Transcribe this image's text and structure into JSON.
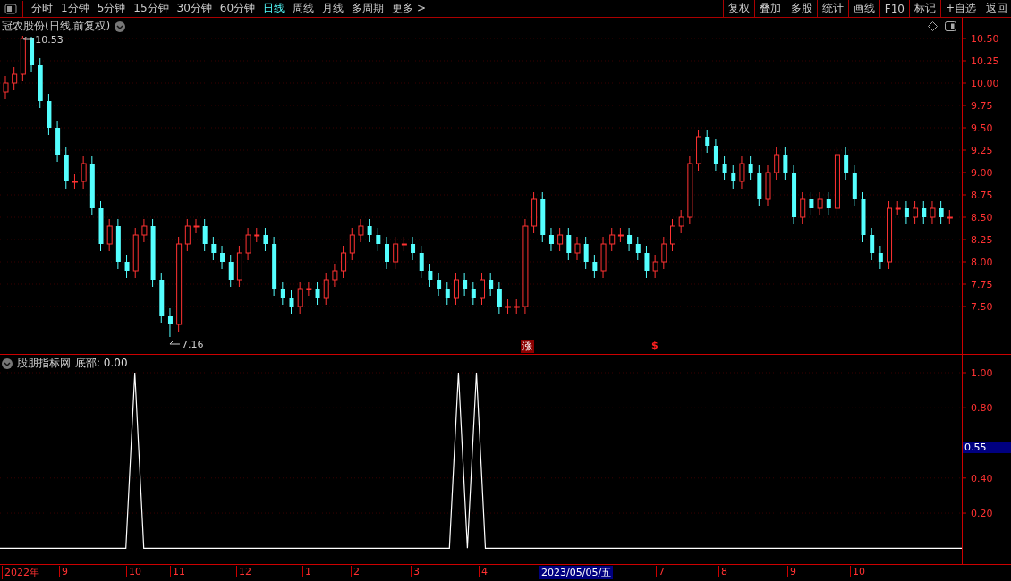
{
  "periods": [
    {
      "label": "分时",
      "selected": false
    },
    {
      "label": "1分钟",
      "selected": false
    },
    {
      "label": "5分钟",
      "selected": false
    },
    {
      "label": "15分钟",
      "selected": false
    },
    {
      "label": "30分钟",
      "selected": false
    },
    {
      "label": "60分钟",
      "selected": false
    },
    {
      "label": "日线",
      "selected": true
    },
    {
      "label": "周线",
      "selected": false
    },
    {
      "label": "月线",
      "selected": false
    },
    {
      "label": "多周期",
      "selected": false
    },
    {
      "label": "更多 >",
      "selected": false
    }
  ],
  "tools": [
    "复权",
    "叠加",
    "多股",
    "统计",
    "画线",
    "F10",
    "标记",
    "+自选",
    "返回"
  ],
  "main_chart": {
    "title": "冠农股份(日线,前复权)",
    "high_label": "10.53",
    "low_label": "7.16",
    "signal_badge": "涨",
    "signal_mark": "$",
    "chart_data": {
      "type": "candlestick",
      "grid": true,
      "ylim": [
        6.96,
        10.73
      ],
      "yticks": [
        {
          "value": 10.5,
          "label": "10.50"
        },
        {
          "value": 10.25,
          "label": "10.25"
        },
        {
          "value": 10,
          "label": "10.00"
        },
        {
          "value": 9.75,
          "label": "9.75"
        },
        {
          "value": 9.5,
          "label": "9.50"
        },
        {
          "value": 9.25,
          "label": "9.25"
        },
        {
          "value": 9,
          "label": "9.00"
        },
        {
          "value": 8.75,
          "label": "8.75"
        },
        {
          "value": 8.5,
          "label": "8.50"
        },
        {
          "value": 8.25,
          "label": "8.25"
        },
        {
          "value": 8,
          "label": "8.00"
        },
        {
          "value": 7.75,
          "label": "7.75"
        },
        {
          "value": 7.5,
          "label": "7.50"
        }
      ],
      "ohlc": [
        [
          9.9,
          10.08,
          9.82,
          10.0
        ],
        [
          10.0,
          10.18,
          9.92,
          10.1
        ],
        [
          10.1,
          10.53,
          10.02,
          10.5
        ],
        [
          10.5,
          10.52,
          10.12,
          10.2
        ],
        [
          10.2,
          10.28,
          9.72,
          9.8
        ],
        [
          9.8,
          9.88,
          9.42,
          9.5
        ],
        [
          9.5,
          9.58,
          9.12,
          9.2
        ],
        [
          9.2,
          9.28,
          8.82,
          8.9
        ],
        [
          8.9,
          8.98,
          8.82,
          8.9
        ],
        [
          8.9,
          9.18,
          8.82,
          9.1
        ],
        [
          9.1,
          9.18,
          8.52,
          8.6
        ],
        [
          8.6,
          8.68,
          8.12,
          8.2
        ],
        [
          8.2,
          8.48,
          8.12,
          8.4
        ],
        [
          8.4,
          8.48,
          7.92,
          8.0
        ],
        [
          8.0,
          8.08,
          7.82,
          7.9
        ],
        [
          7.9,
          8.38,
          7.82,
          8.3
        ],
        [
          8.3,
          8.48,
          8.22,
          8.4
        ],
        [
          8.4,
          8.48,
          7.72,
          7.8
        ],
        [
          7.8,
          7.88,
          7.32,
          7.4
        ],
        [
          7.4,
          7.48,
          7.16,
          7.3
        ],
        [
          7.3,
          8.28,
          7.22,
          8.2
        ],
        [
          8.2,
          8.48,
          8.12,
          8.4
        ],
        [
          8.4,
          8.48,
          8.32,
          8.4
        ],
        [
          8.4,
          8.48,
          8.12,
          8.2
        ],
        [
          8.2,
          8.28,
          8.02,
          8.1
        ],
        [
          8.1,
          8.18,
          7.92,
          8.0
        ],
        [
          8.0,
          8.08,
          7.72,
          7.8
        ],
        [
          7.8,
          8.18,
          7.72,
          8.1
        ],
        [
          8.1,
          8.38,
          8.02,
          8.3
        ],
        [
          8.3,
          8.38,
          8.22,
          8.3
        ],
        [
          8.3,
          8.38,
          8.12,
          8.2
        ],
        [
          8.2,
          8.28,
          7.62,
          7.7
        ],
        [
          7.7,
          7.78,
          7.52,
          7.6
        ],
        [
          7.6,
          7.68,
          7.42,
          7.5
        ],
        [
          7.5,
          7.78,
          7.42,
          7.7
        ],
        [
          7.7,
          7.78,
          7.62,
          7.7
        ],
        [
          7.7,
          7.78,
          7.52,
          7.6
        ],
        [
          7.6,
          7.88,
          7.52,
          7.8
        ],
        [
          7.8,
          7.98,
          7.72,
          7.9
        ],
        [
          7.9,
          8.18,
          7.82,
          8.1
        ],
        [
          8.1,
          8.38,
          8.02,
          8.3
        ],
        [
          8.3,
          8.48,
          8.22,
          8.4
        ],
        [
          8.4,
          8.48,
          8.22,
          8.3
        ],
        [
          8.3,
          8.38,
          8.12,
          8.2
        ],
        [
          8.2,
          8.28,
          7.92,
          8.0
        ],
        [
          8.0,
          8.28,
          7.92,
          8.2
        ],
        [
          8.2,
          8.28,
          8.12,
          8.2
        ],
        [
          8.2,
          8.28,
          8.02,
          8.1
        ],
        [
          8.1,
          8.18,
          7.82,
          7.9
        ],
        [
          7.9,
          7.98,
          7.72,
          7.8
        ],
        [
          7.8,
          7.88,
          7.62,
          7.7
        ],
        [
          7.7,
          7.78,
          7.52,
          7.6
        ],
        [
          7.6,
          7.88,
          7.52,
          7.8
        ],
        [
          7.8,
          7.88,
          7.62,
          7.7
        ],
        [
          7.7,
          7.78,
          7.52,
          7.6
        ],
        [
          7.6,
          7.88,
          7.52,
          7.8
        ],
        [
          7.8,
          7.88,
          7.62,
          7.7
        ],
        [
          7.7,
          7.78,
          7.42,
          7.5
        ],
        [
          7.5,
          7.58,
          7.42,
          7.5
        ],
        [
          7.5,
          7.58,
          7.42,
          7.5
        ],
        [
          7.5,
          8.48,
          7.42,
          8.4
        ],
        [
          8.4,
          8.78,
          8.32,
          8.7
        ],
        [
          8.7,
          8.78,
          8.22,
          8.3
        ],
        [
          8.3,
          8.38,
          8.12,
          8.2
        ],
        [
          8.2,
          8.38,
          8.12,
          8.3
        ],
        [
          8.3,
          8.38,
          8.02,
          8.1
        ],
        [
          8.1,
          8.28,
          8.02,
          8.2
        ],
        [
          8.2,
          8.28,
          7.92,
          8.0
        ],
        [
          8.0,
          8.08,
          7.82,
          7.9
        ],
        [
          7.9,
          8.28,
          7.82,
          8.2
        ],
        [
          8.2,
          8.38,
          8.12,
          8.3
        ],
        [
          8.3,
          8.38,
          8.22,
          8.3
        ],
        [
          8.3,
          8.38,
          8.12,
          8.2
        ],
        [
          8.2,
          8.28,
          8.02,
          8.1
        ],
        [
          8.1,
          8.18,
          7.82,
          7.9
        ],
        [
          7.9,
          8.08,
          7.82,
          8.0
        ],
        [
          8.0,
          8.28,
          7.92,
          8.2
        ],
        [
          8.2,
          8.48,
          8.12,
          8.4
        ],
        [
          8.4,
          8.58,
          8.32,
          8.5
        ],
        [
          8.5,
          9.18,
          8.42,
          9.1
        ],
        [
          9.1,
          9.48,
          9.02,
          9.4
        ],
        [
          9.4,
          9.48,
          9.22,
          9.3
        ],
        [
          9.3,
          9.38,
          9.02,
          9.1
        ],
        [
          9.1,
          9.18,
          8.92,
          9.0
        ],
        [
          9.0,
          9.08,
          8.82,
          8.9
        ],
        [
          8.9,
          9.18,
          8.82,
          9.1
        ],
        [
          9.1,
          9.18,
          8.92,
          9.0
        ],
        [
          9.0,
          9.08,
          8.62,
          8.7
        ],
        [
          8.7,
          9.08,
          8.62,
          9.0
        ],
        [
          9.0,
          9.28,
          8.92,
          9.2
        ],
        [
          9.2,
          9.28,
          8.92,
          9.0
        ],
        [
          9.0,
          9.08,
          8.42,
          8.5
        ],
        [
          8.5,
          8.78,
          8.42,
          8.7
        ],
        [
          8.7,
          8.78,
          8.52,
          8.6
        ],
        [
          8.6,
          8.78,
          8.52,
          8.7
        ],
        [
          8.7,
          8.78,
          8.52,
          8.6
        ],
        [
          8.6,
          9.28,
          8.52,
          9.2
        ],
        [
          9.2,
          9.28,
          8.92,
          9.0
        ],
        [
          9.0,
          9.08,
          8.62,
          8.7
        ],
        [
          8.7,
          8.78,
          8.22,
          8.3
        ],
        [
          8.3,
          8.38,
          8.02,
          8.1
        ],
        [
          8.1,
          8.18,
          7.92,
          8.0
        ],
        [
          8.0,
          8.68,
          7.92,
          8.6
        ],
        [
          8.6,
          8.68,
          8.52,
          8.6
        ],
        [
          8.6,
          8.68,
          8.42,
          8.5
        ],
        [
          8.5,
          8.68,
          8.42,
          8.6
        ],
        [
          8.6,
          8.68,
          8.42,
          8.5
        ],
        [
          8.5,
          8.68,
          8.42,
          8.6
        ],
        [
          8.6,
          8.68,
          8.42,
          8.5
        ],
        [
          8.5,
          8.58,
          8.42,
          8.5
        ]
      ]
    }
  },
  "indicator": {
    "name": "股朋指标网",
    "reading": ": 0.00",
    "cursor_value": "0.55",
    "chart_data": {
      "type": "line",
      "grid": true,
      "ylim": [
        -0.0952,
        1.0
      ],
      "yticks": [
        {
          "value": 0.2,
          "label": "0.20"
        },
        {
          "value": 0.4,
          "label": "0.40"
        },
        {
          "value": 0.8,
          "label": "0.80"
        },
        {
          "value": 1,
          "label": "1.00"
        }
      ],
      "series": [
        {
          "name": "底部",
          "color": "#ffffff",
          "values": [
            0,
            0,
            0,
            0,
            0,
            0,
            0,
            0,
            0,
            0,
            0,
            0,
            0,
            0,
            0,
            1,
            0,
            0,
            0,
            0,
            0,
            0,
            0,
            0,
            0,
            0,
            0,
            0,
            0,
            0,
            0,
            0,
            0,
            0,
            0,
            0,
            0,
            0,
            0,
            0,
            0,
            0,
            0,
            0,
            0,
            0,
            0,
            0,
            0,
            0,
            0,
            1,
            0,
            1,
            0,
            0,
            0,
            0,
            0,
            0,
            0,
            0,
            0,
            0,
            0,
            0,
            0,
            0,
            0,
            0,
            0,
            0,
            0,
            0,
            0,
            0,
            0,
            0,
            0,
            0,
            0,
            0,
            0,
            0,
            0,
            0,
            0,
            0,
            0,
            0,
            0,
            0,
            0,
            0,
            0,
            0,
            0,
            0,
            0,
            0,
            0,
            0,
            0,
            0,
            0,
            0,
            0,
            0
          ]
        }
      ]
    }
  },
  "x_axis": [
    "2022年",
    "9",
    "10",
    "11",
    "12",
    "1",
    "2",
    "3",
    "4",
    "7",
    "8",
    "9",
    "10"
  ],
  "cursor_date": "2023/05/05/五"
}
